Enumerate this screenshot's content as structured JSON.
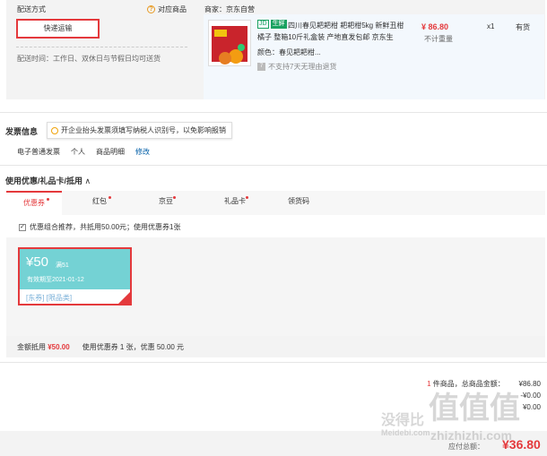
{
  "shipping": {
    "title": "配送方式",
    "help": "对应商品",
    "method": "快递运输",
    "time": "配送时间：工作日、双休日与节假日均可送货"
  },
  "product": {
    "merchant": "商家：京东自营",
    "tag_jd": "JD",
    "tag_fresh": "生鲜",
    "name": "四川春见耙耙柑 耙耙柑5kg 新鲜丑柑橘子 整箱10斤礼盒装 产地直发包邮 京东生",
    "color": "颜色：春见耙耙柑...",
    "return_policy": "不支持7天无理由退货",
    "price": "¥ 86.80",
    "weight": "不计重量",
    "qty": "x1",
    "stock": "有货"
  },
  "invoice": {
    "title": "发票信息",
    "tip": "开企业抬头发票须填写纳税人识别号，以免影响报销",
    "type": "电子普通发票",
    "holder": "个人",
    "content": "商品明细",
    "edit": "修改"
  },
  "coupons": {
    "title": "使用优惠/礼品卡/抵用",
    "tabs": [
      "优惠券",
      "红包",
      "京豆",
      "礼品卡",
      "领货码"
    ],
    "recommend": "优惠组合推荐，共抵用50.00元；使用优惠券1张",
    "coupon": {
      "amount": "¥50",
      "condition": "满51",
      "valid": "有效期至2021-01-12",
      "scope": "[东券]  [限品类]"
    },
    "summary_label": "金额抵用",
    "summary_amount": "¥50.00",
    "summary_text": "使用优惠券 1 张，优惠 50.00 元"
  },
  "totals": {
    "count_prefix": "1",
    "count_text": " 件商品，总商品金额：",
    "goods_amount": "¥86.80",
    "line2": "-¥0.00",
    "line3": "¥0.00",
    "pay_label": "应付总额：",
    "pay_amount": "¥36.80"
  },
  "watermark": {
    "text1": "没得比",
    "text2": "Meidebi.com",
    "text3": "值值值",
    "text4": "zhizhizhi.com"
  },
  "colors": {
    "accent": "#e4393c",
    "coupon_bg": "#74d2d4",
    "link": "#005ea7",
    "fresh_green": "#1aa260"
  }
}
